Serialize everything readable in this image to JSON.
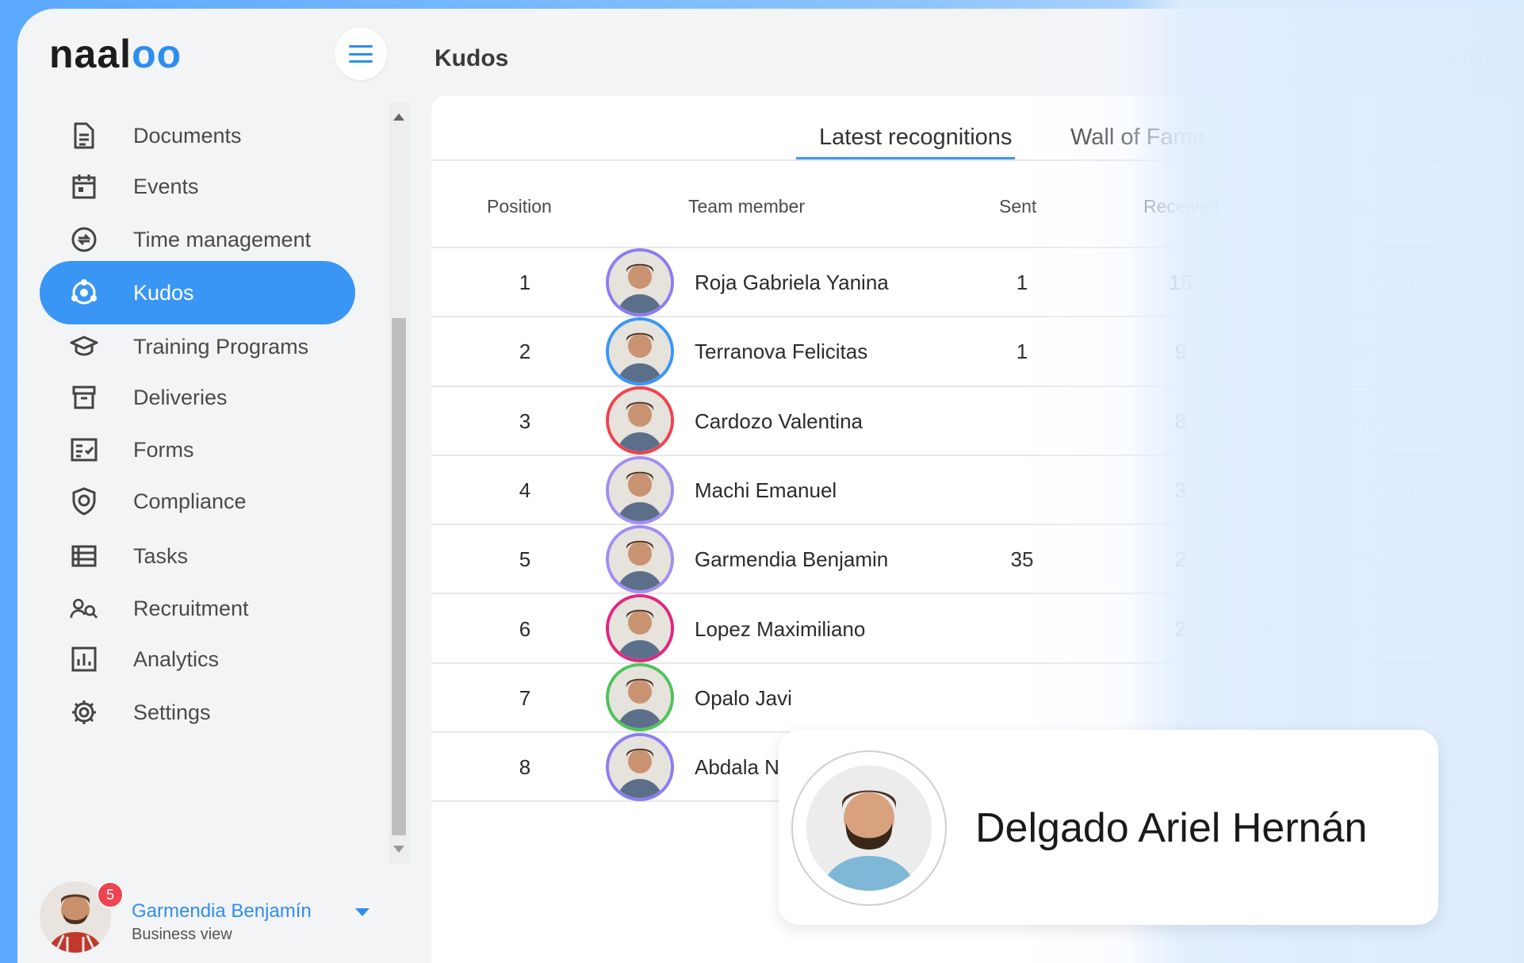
{
  "app": {
    "logo_text": "naaloo",
    "page_title": "Kudos",
    "assign_label": "+ Assign training"
  },
  "sidebar": {
    "items": [
      {
        "label": "Documents",
        "icon": "document-icon"
      },
      {
        "label": "Events",
        "icon": "calendar-icon"
      },
      {
        "label": "Time management",
        "icon": "clock-swap-icon"
      },
      {
        "label": "Kudos",
        "icon": "kudos-icon",
        "active": true
      },
      {
        "label": "Training Programs",
        "icon": "graduation-cap-icon"
      },
      {
        "label": "Deliveries",
        "icon": "archive-box-icon"
      },
      {
        "label": "Forms",
        "icon": "form-checklist-icon"
      },
      {
        "label": "Compliance",
        "icon": "shield-icon"
      },
      {
        "label": "Tasks",
        "icon": "list-icon"
      },
      {
        "label": "Recruitment",
        "icon": "people-search-icon"
      },
      {
        "label": "Analytics",
        "icon": "bar-chart-icon"
      },
      {
        "label": "Settings",
        "icon": "gear-icon"
      }
    ]
  },
  "user": {
    "name": "Garmendia Benjamín",
    "subtitle": "Business view",
    "notifications": "5"
  },
  "tabs": [
    {
      "label": "Latest recognitions",
      "active": true
    },
    {
      "label": "Wall of Fame",
      "active": false
    }
  ],
  "table": {
    "headers": {
      "position": "Position",
      "member": "Team member",
      "sent": "Sent",
      "received": "Received",
      "featured": "Featured in"
    },
    "rows": [
      {
        "position": "1",
        "member": "Roja Gabriela Yanina",
        "sent": "1",
        "received": "15",
        "featured": "Team work",
        "dot_color": "#8e7df0",
        "ring_color": "#8e7df0"
      },
      {
        "position": "2",
        "member": "Terranova Felicitas",
        "sent": "1",
        "received": "9",
        "featured": "Kudos",
        "dot_color": "#3a96f5",
        "ring_color": "#3a96f5"
      },
      {
        "position": "3",
        "member": "Cardozo Valentina",
        "sent": "",
        "received": "8",
        "featured": "Funny",
        "dot_color": "#ef4350",
        "ring_color": "#ef4350"
      },
      {
        "position": "4",
        "member": "Machi Emanuel",
        "sent": "",
        "received": "3",
        "featured": "Team work",
        "dot_color": "#8e7df0",
        "ring_color": "#a28ef2"
      },
      {
        "position": "5",
        "member": "Garmendia Benjamin",
        "sent": "35",
        "received": "2",
        "featured": "Team work",
        "dot_color": "#8e7df0",
        "ring_color": "#a28ef2"
      },
      {
        "position": "6",
        "member": "Lopez Maximiliano",
        "sent": "",
        "received": "2",
        "featured": "Best teammate",
        "dot_color": "#e0287e",
        "ring_color": "#e0287e"
      },
      {
        "position": "7",
        "member": "Opalo Javi",
        "sent": "",
        "received": "",
        "featured": "nce",
        "dot_color": "#4fc45a",
        "ring_color": "#4fc45a"
      },
      {
        "position": "8",
        "member": "Abdala Nes",
        "sent": "",
        "received": "",
        "featured": "",
        "dot_color": "#8e7df0",
        "ring_color": "#8e7df0"
      }
    ]
  },
  "popup": {
    "name": "Delgado Ariel Hernán"
  },
  "colors": {
    "accent": "#3a96f5",
    "badge": "#ef4350"
  }
}
